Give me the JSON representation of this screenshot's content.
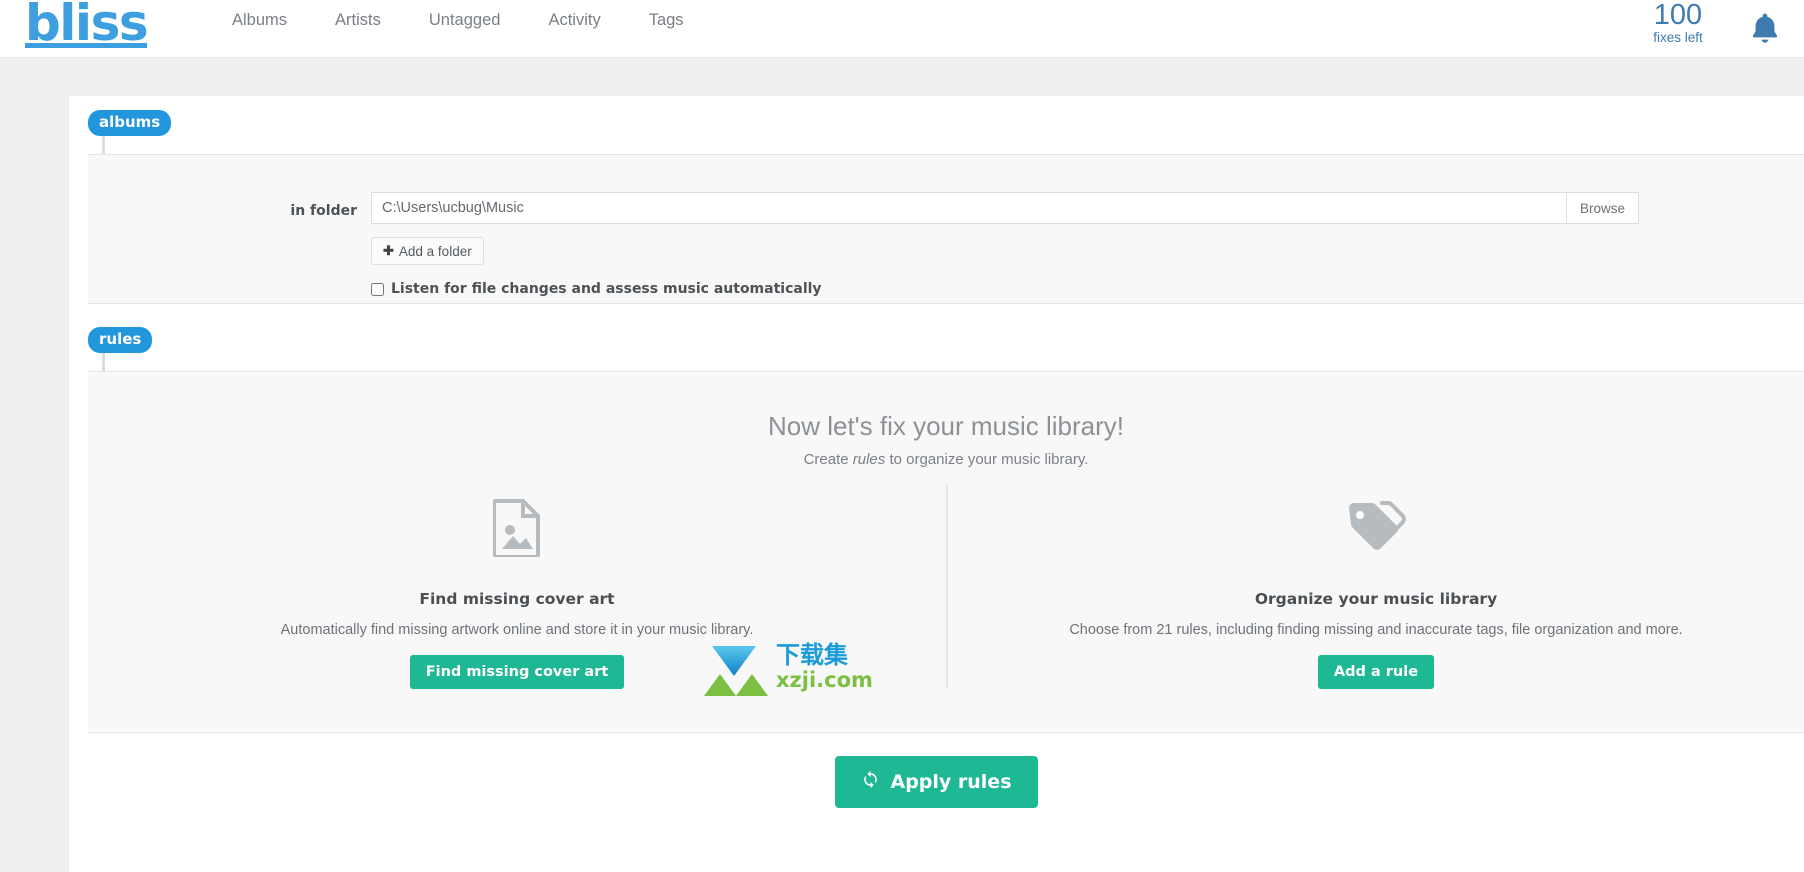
{
  "header": {
    "brand": "bliss",
    "nav": [
      {
        "label": "Albums",
        "name": "nav-albums"
      },
      {
        "label": "Artists",
        "name": "nav-artists"
      },
      {
        "label": "Untagged",
        "name": "nav-untagged"
      },
      {
        "label": "Activity",
        "name": "nav-activity"
      },
      {
        "label": "Tags",
        "name": "nav-tags"
      }
    ],
    "fixes_count": "100",
    "fixes_label": "fixes left",
    "bell_icon": "bell-icon",
    "brand_color": "#3d9fe0",
    "fixes_color": "#3f7bb0"
  },
  "albums": {
    "tab_label": "albums",
    "in_folder_label": "in folder",
    "folder_value": "C:\\Users\\ucbug\\Music",
    "folder_placeholder": "",
    "browse_label": "Browse",
    "add_folder_label": "Add a folder",
    "add_folder_icon": "plus-icon",
    "listen_label": "Listen for file changes and assess music automatically",
    "listen_checked": false
  },
  "rules": {
    "tab_label": "rules",
    "title": "Now let's fix your music library!",
    "subtitle_before": "Create ",
    "subtitle_em": "rules",
    "subtitle_after": " to organize your music library.",
    "features": [
      {
        "icon": "image-file-icon",
        "title": "Find missing cover art",
        "desc": "Automatically find missing artwork online and store it in your music library.",
        "button_label": "Find missing cover art",
        "button_name": "find-missing-cover-art-button"
      },
      {
        "icon": "tag-icon",
        "title": "Organize your music library",
        "desc": "Choose from 21 rules, including finding missing and inaccurate tags, file organization and more.",
        "button_label": "Add a rule",
        "button_name": "add-a-rule-button"
      }
    ],
    "apply_label": "Apply rules",
    "apply_icon": "refresh-icon",
    "accent_green": "#1fb894",
    "tab_blue": "#2196dd"
  },
  "watermark": {
    "text_top": "下载集",
    "text_bottom": "xzji.com"
  }
}
